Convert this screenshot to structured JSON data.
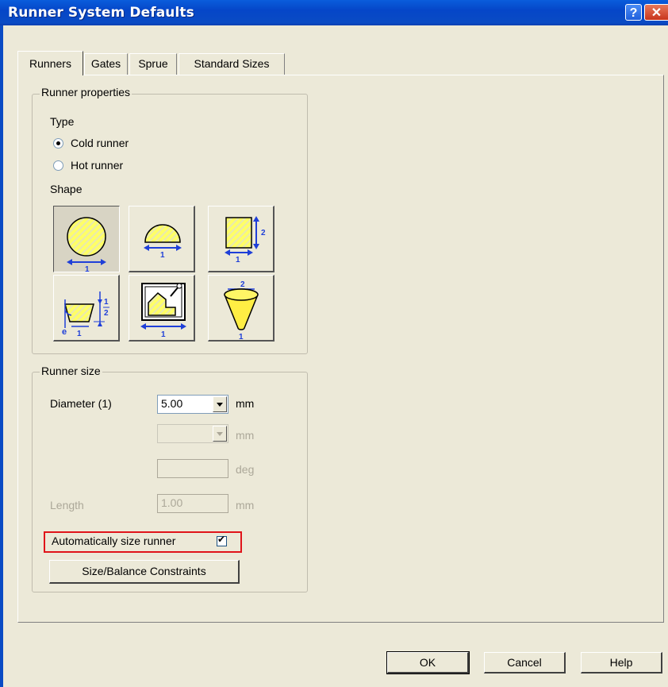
{
  "window": {
    "title": "Runner System Defaults",
    "help_glyph": "?",
    "close_glyph": "✕"
  },
  "tabs": [
    {
      "label": "Runners",
      "active": true
    },
    {
      "label": "Gates",
      "active": false
    },
    {
      "label": "Sprue",
      "active": false
    },
    {
      "label": "Standard Sizes",
      "active": false
    }
  ],
  "runner_properties": {
    "group_label": "Runner properties",
    "type_label": "Type",
    "radios": [
      {
        "label": "Cold runner",
        "selected": true
      },
      {
        "label": "Hot runner",
        "selected": false
      }
    ],
    "shape_label": "Shape",
    "shapes": [
      {
        "name": "circular-shape-icon",
        "selected": true
      },
      {
        "name": "half-circle-shape-icon",
        "selected": false
      },
      {
        "name": "rectangle-shape-icon",
        "selected": false
      },
      {
        "name": "trapezoid-shape-icon",
        "selected": false
      },
      {
        "name": "custom-shape-icon",
        "selected": false
      },
      {
        "name": "cone-shape-icon",
        "selected": false
      }
    ]
  },
  "runner_size": {
    "group_label": "Runner size",
    "diameter_label": "Diameter (1)",
    "diameter_value": "5.00",
    "diameter_unit": "mm",
    "dim2_unit": "mm",
    "angle_unit": "deg",
    "length_label": "Length",
    "length_value": "1.00",
    "length_unit": "mm",
    "auto_size_label": "Automatically size runner",
    "auto_size_checked": true,
    "constraints_button": "Size/Balance Constraints"
  },
  "buttons": {
    "ok": "OK",
    "cancel": "Cancel",
    "help": "Help"
  },
  "colors": {
    "title_bar": "#0a4bc4",
    "shape_fill": "#ffff66",
    "dimension_arrow": "#1f3fd8",
    "highlight_box": "#e0141a"
  }
}
